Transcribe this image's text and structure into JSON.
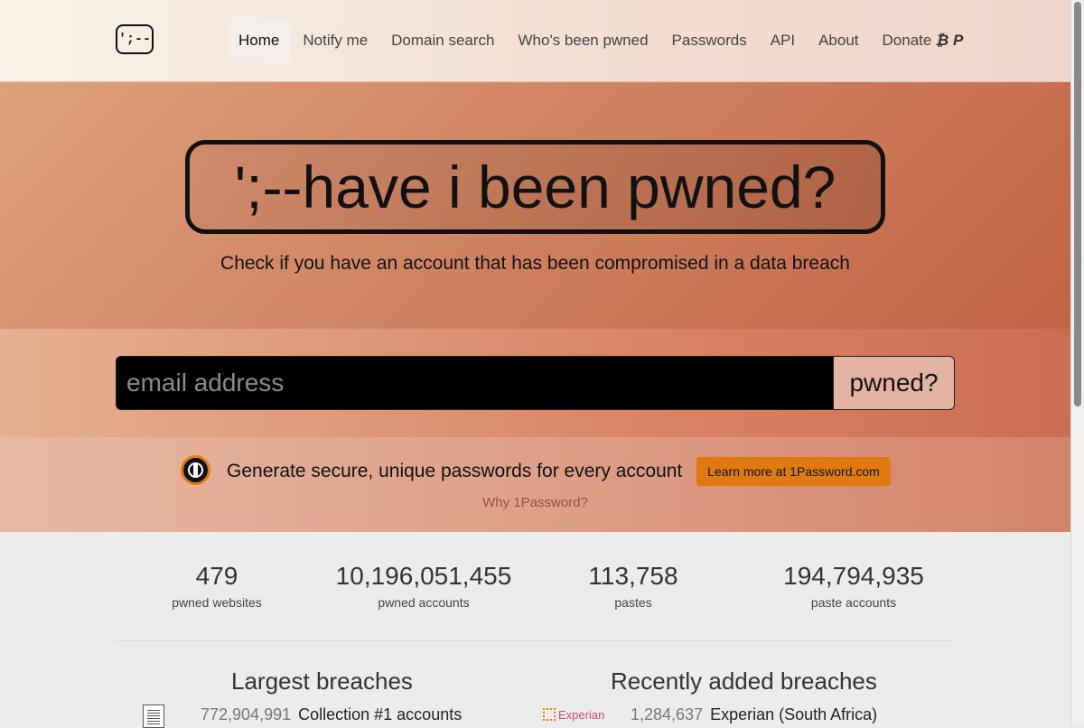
{
  "nav": {
    "logo_text": "';--",
    "items": [
      {
        "label": "Home",
        "active": true
      },
      {
        "label": "Notify me"
      },
      {
        "label": "Domain search"
      },
      {
        "label": "Who's been pwned"
      },
      {
        "label": "Passwords"
      },
      {
        "label": "API"
      },
      {
        "label": "About"
      },
      {
        "label": "Donate"
      }
    ],
    "donate_icons": [
      "bitcoin-icon",
      "paypal-icon"
    ]
  },
  "hero": {
    "title": "';--have i been pwned?",
    "tagline": "Check if you have an account that has been compromised in a data breach"
  },
  "search": {
    "placeholder": "email address",
    "button_label": "pwned?"
  },
  "promo": {
    "text": "Generate secure, unique passwords for every account",
    "button_label": "Learn more at 1Password.com",
    "link_label": "Why 1Password?"
  },
  "stats": [
    {
      "value": "479",
      "label": "pwned websites"
    },
    {
      "value": "10,196,051,455",
      "label": "pwned accounts"
    },
    {
      "value": "113,758",
      "label": "pastes"
    },
    {
      "value": "194,794,935",
      "label": "paste accounts"
    }
  ],
  "largest_breaches": {
    "title": "Largest breaches",
    "items": [
      {
        "count": "772,904,991",
        "name": "Collection #1 accounts"
      }
    ]
  },
  "recent_breaches": {
    "title": "Recently added breaches",
    "items": [
      {
        "count": "1,284,637",
        "name": "Experian (South Africa)",
        "logo_text": "Experian"
      }
    ]
  },
  "colors": {
    "hero_gradient_start": "#dfa07e",
    "hero_gradient_end": "#c36444",
    "promo_button": "#e07a10"
  }
}
